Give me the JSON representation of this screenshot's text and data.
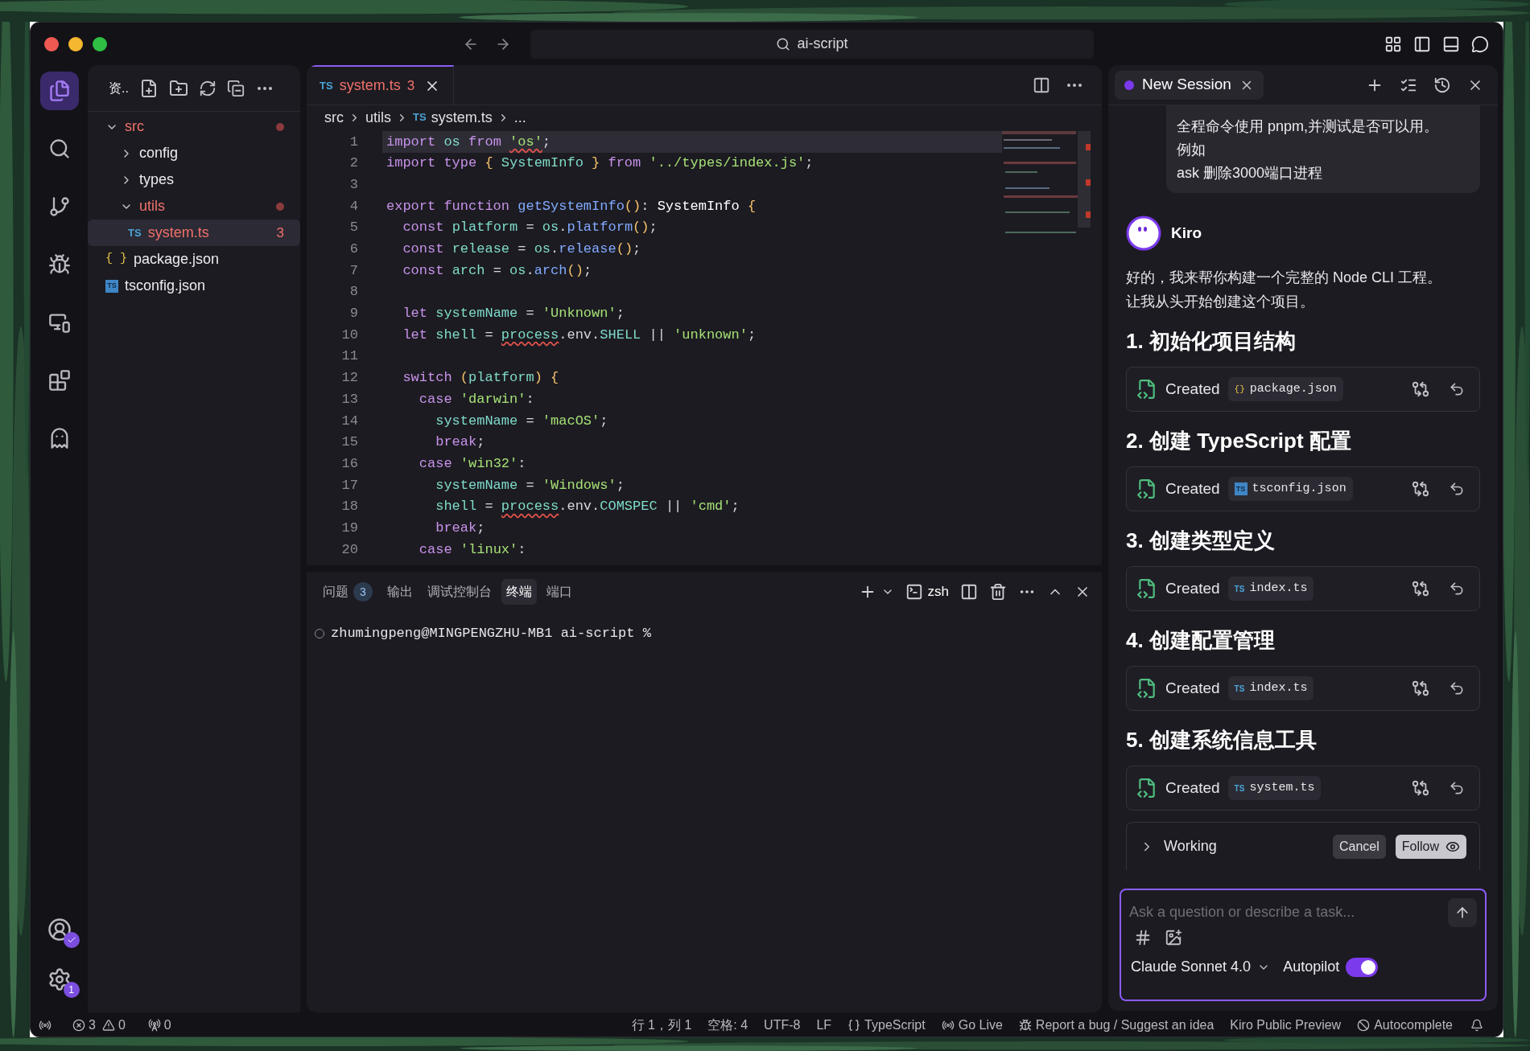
{
  "window": {
    "search": "ai-script"
  },
  "activity_bar": {
    "items": [
      {
        "kind": "files",
        "selected": true
      },
      {
        "kind": "search",
        "selected": false
      },
      {
        "kind": "branch",
        "selected": false
      },
      {
        "kind": "debug",
        "selected": false
      },
      {
        "kind": "remote",
        "selected": false
      },
      {
        "kind": "extensions",
        "selected": false
      },
      {
        "kind": "ghost",
        "selected": false
      }
    ],
    "account": {
      "verified": true
    },
    "settings": {
      "badge": "1"
    }
  },
  "explorer": {
    "title": "资..",
    "tree": [
      {
        "name": "src",
        "kind": "folder",
        "expanded": true,
        "has_errors": true,
        "selected": false,
        "children": [
          {
            "name": "config",
            "kind": "folder",
            "expanded": false,
            "has_errors": false,
            "selected": false
          },
          {
            "name": "types",
            "kind": "folder",
            "expanded": false,
            "has_errors": false,
            "selected": false
          },
          {
            "name": "utils",
            "kind": "folder",
            "expanded": true,
            "has_errors": true,
            "selected": false,
            "children": [
              {
                "name": "system.ts",
                "kind": "ts",
                "icon_label": "TS",
                "problems": "3",
                "has_errors": true,
                "selected": true
              }
            ]
          }
        ]
      },
      {
        "name": "package.json",
        "kind": "json",
        "icon_label": "{ }",
        "has_errors": false,
        "selected": false
      },
      {
        "name": "tsconfig.json",
        "kind": "tsconfig",
        "icon_label": "TS",
        "has_errors": false,
        "selected": false
      }
    ]
  },
  "editor": {
    "tab": {
      "icon_label": "TS",
      "name": "system.ts",
      "problems": "3",
      "selected": true
    },
    "breadcrumb": [
      {
        "label": "src"
      },
      {
        "label": "utils"
      },
      {
        "label": "system.ts",
        "icon_label": "TS"
      },
      {
        "label": "..."
      }
    ],
    "lines": [
      {
        "number": "1",
        "current": true,
        "tokens": [
          {
            "text": "import ",
            "kind": "keyword"
          },
          {
            "text": "os ",
            "kind": "ident"
          },
          {
            "text": "from ",
            "kind": "keyword"
          },
          {
            "text": "'os'",
            "kind": "string-error"
          },
          {
            "text": ";",
            "kind": "plain"
          }
        ]
      },
      {
        "number": "2",
        "current": false,
        "tokens": [
          {
            "text": "import type ",
            "kind": "keyword"
          },
          {
            "text": "{ ",
            "kind": "brace"
          },
          {
            "text": "SystemInfo ",
            "kind": "ident"
          },
          {
            "text": "} ",
            "kind": "brace"
          },
          {
            "text": "from ",
            "kind": "keyword"
          },
          {
            "text": "'../types/index.js'",
            "kind": "string"
          },
          {
            "text": ";",
            "kind": "plain"
          }
        ]
      },
      {
        "number": "3",
        "current": false
      },
      {
        "number": "4",
        "current": false,
        "tokens": [
          {
            "text": "export function ",
            "kind": "keyword"
          },
          {
            "text": "getSystemInfo",
            "kind": "func"
          },
          {
            "text": "()",
            "kind": "brace"
          },
          {
            "text": ": ",
            "kind": "plain"
          },
          {
            "text": "SystemInfo ",
            "kind": "type"
          },
          {
            "text": "{",
            "kind": "brace"
          }
        ]
      },
      {
        "number": "5",
        "current": false,
        "tokens": [
          {
            "text": "  const ",
            "kind": "keyword"
          },
          {
            "text": "platform ",
            "kind": "ident"
          },
          {
            "text": "= ",
            "kind": "plain"
          },
          {
            "text": "os",
            "kind": "ident"
          },
          {
            "text": ".",
            "kind": "plain"
          },
          {
            "text": "platform",
            "kind": "func"
          },
          {
            "text": "()",
            "kind": "brace"
          },
          {
            "text": ";",
            "kind": "plain"
          }
        ]
      },
      {
        "number": "6",
        "current": false,
        "tokens": [
          {
            "text": "  const ",
            "kind": "keyword"
          },
          {
            "text": "release ",
            "kind": "ident"
          },
          {
            "text": "= ",
            "kind": "plain"
          },
          {
            "text": "os",
            "kind": "ident"
          },
          {
            "text": ".",
            "kind": "plain"
          },
          {
            "text": "release",
            "kind": "func"
          },
          {
            "text": "()",
            "kind": "brace"
          },
          {
            "text": ";",
            "kind": "plain"
          }
        ]
      },
      {
        "number": "7",
        "current": false,
        "tokens": [
          {
            "text": "  const ",
            "kind": "keyword"
          },
          {
            "text": "arch ",
            "kind": "ident"
          },
          {
            "text": "= ",
            "kind": "plain"
          },
          {
            "text": "os",
            "kind": "ident"
          },
          {
            "text": ".",
            "kind": "plain"
          },
          {
            "text": "arch",
            "kind": "func"
          },
          {
            "text": "()",
            "kind": "brace"
          },
          {
            "text": ";",
            "kind": "plain"
          }
        ]
      },
      {
        "number": "8",
        "current": false
      },
      {
        "number": "9",
        "current": false,
        "tokens": [
          {
            "text": "  let ",
            "kind": "keyword"
          },
          {
            "text": "systemName ",
            "kind": "ident"
          },
          {
            "text": "= ",
            "kind": "plain"
          },
          {
            "text": "'Unknown'",
            "kind": "string"
          },
          {
            "text": ";",
            "kind": "plain"
          }
        ]
      },
      {
        "number": "10",
        "current": false,
        "tokens": [
          {
            "text": "  let ",
            "kind": "keyword"
          },
          {
            "text": "shell ",
            "kind": "ident"
          },
          {
            "text": "= ",
            "kind": "plain"
          },
          {
            "text": "process",
            "kind": "ident-error"
          },
          {
            "text": ".env.",
            "kind": "plain"
          },
          {
            "text": "SHELL ",
            "kind": "ident"
          },
          {
            "text": "|| ",
            "kind": "plain"
          },
          {
            "text": "'unknown'",
            "kind": "string"
          },
          {
            "text": ";",
            "kind": "plain"
          }
        ]
      },
      {
        "number": "11",
        "current": false
      },
      {
        "number": "12",
        "current": false,
        "tokens": [
          {
            "text": "  switch ",
            "kind": "keyword"
          },
          {
            "text": "(",
            "kind": "brace"
          },
          {
            "text": "platform",
            "kind": "ident"
          },
          {
            "text": ") ",
            "kind": "brace"
          },
          {
            "text": "{",
            "kind": "brace"
          }
        ]
      },
      {
        "number": "13",
        "current": false,
        "tokens": [
          {
            "text": "    case ",
            "kind": "keyword"
          },
          {
            "text": "'darwin'",
            "kind": "string"
          },
          {
            "text": ":",
            "kind": "plain"
          }
        ]
      },
      {
        "number": "14",
        "current": false,
        "tokens": [
          {
            "text": "      systemName ",
            "kind": "ident"
          },
          {
            "text": "= ",
            "kind": "plain"
          },
          {
            "text": "'macOS'",
            "kind": "string"
          },
          {
            "text": ";",
            "kind": "plain"
          }
        ]
      },
      {
        "number": "15",
        "current": false,
        "tokens": [
          {
            "text": "      break",
            "kind": "keyword"
          },
          {
            "text": ";",
            "kind": "plain"
          }
        ]
      },
      {
        "number": "16",
        "current": false,
        "tokens": [
          {
            "text": "    case ",
            "kind": "keyword"
          },
          {
            "text": "'win32'",
            "kind": "string"
          },
          {
            "text": ":",
            "kind": "plain"
          }
        ]
      },
      {
        "number": "17",
        "current": false,
        "tokens": [
          {
            "text": "      systemName ",
            "kind": "ident"
          },
          {
            "text": "= ",
            "kind": "plain"
          },
          {
            "text": "'Windows'",
            "kind": "string"
          },
          {
            "text": ";",
            "kind": "plain"
          }
        ]
      },
      {
        "number": "18",
        "current": false,
        "tokens": [
          {
            "text": "      shell ",
            "kind": "ident"
          },
          {
            "text": "= ",
            "kind": "plain"
          },
          {
            "text": "process",
            "kind": "ident-error"
          },
          {
            "text": ".env.",
            "kind": "plain"
          },
          {
            "text": "COMSPEC ",
            "kind": "ident"
          },
          {
            "text": "|| ",
            "kind": "plain"
          },
          {
            "text": "'cmd'",
            "kind": "string"
          },
          {
            "text": ";",
            "kind": "plain"
          }
        ]
      },
      {
        "number": "19",
        "current": false,
        "tokens": [
          {
            "text": "      break",
            "kind": "keyword"
          },
          {
            "text": ";",
            "kind": "plain"
          }
        ]
      },
      {
        "number": "20",
        "current": false,
        "tokens": [
          {
            "text": "    case ",
            "kind": "keyword"
          },
          {
            "text": "'linux'",
            "kind": "string"
          },
          {
            "text": ":",
            "kind": "plain"
          }
        ]
      }
    ]
  },
  "panel": {
    "tabs": [
      {
        "label": "问题",
        "badge": "3",
        "selected": false
      },
      {
        "label": "输出",
        "selected": false
      },
      {
        "label": "调试控制台",
        "selected": false
      },
      {
        "label": "终端",
        "selected": true
      },
      {
        "label": "端口",
        "selected": false
      }
    ],
    "shell": "zsh",
    "terminal_line": "zhumingpeng@MINGPENGZHU-MB1 ai-script %"
  },
  "chat": {
    "tab": {
      "label": "New Session"
    },
    "user_message": [
      "全程命令使用 pnpm,并测试是否可以用。",
      "例如",
      "ask 删除3000端口进程"
    ],
    "assistant": "Kiro",
    "response": [
      "好的，我来帮你构建一个完整的 Node CLI 工程。",
      "让我从头开始创建这个项目。"
    ],
    "steps": [
      {
        "heading": "1. 初始化项目结构",
        "action": "Created",
        "file": {
          "name": "package.json",
          "kind": "json",
          "icon_label": "{}"
        }
      },
      {
        "heading": "2. 创建 TypeScript 配置",
        "action": "Created",
        "file": {
          "name": "tsconfig.json",
          "kind": "tsconfig",
          "icon_label": "TS"
        }
      },
      {
        "heading": "3. 创建类型定义",
        "action": "Created",
        "file": {
          "name": "index.ts",
          "kind": "ts",
          "icon_label": "TS"
        }
      },
      {
        "heading": "4. 创建配置管理",
        "action": "Created",
        "file": {
          "name": "index.ts",
          "kind": "ts",
          "icon_label": "TS"
        }
      },
      {
        "heading": "5. 创建系统信息工具",
        "action": "Created",
        "file": {
          "name": "system.ts",
          "kind": "ts",
          "icon_label": "TS"
        }
      }
    ],
    "working": {
      "label": "Working",
      "expanded": false,
      "cancel": "Cancel",
      "follow": "Follow"
    },
    "input": {
      "placeholder": "Ask a question or describe a task...",
      "model": "Claude Sonnet 4.0",
      "autopilot": {
        "label": "Autopilot",
        "on": true
      }
    }
  },
  "status_bar": {
    "errors": "3",
    "warnings": "0",
    "ports": "0",
    "right": [
      {
        "kind": "plain",
        "label": "行 1，列 1"
      },
      {
        "kind": "plain",
        "label": "空格: 4"
      },
      {
        "kind": "plain",
        "label": "UTF-8"
      },
      {
        "kind": "plain",
        "label": "LF"
      },
      {
        "kind": "language",
        "label": "TypeScript"
      },
      {
        "kind": "live",
        "label": "Go Live"
      },
      {
        "kind": "feedback",
        "label": "Report a bug / Suggest an idea"
      },
      {
        "kind": "plain",
        "label": "Kiro Public Preview"
      },
      {
        "kind": "autocomplete",
        "label": "Autocomplete"
      }
    ]
  }
}
